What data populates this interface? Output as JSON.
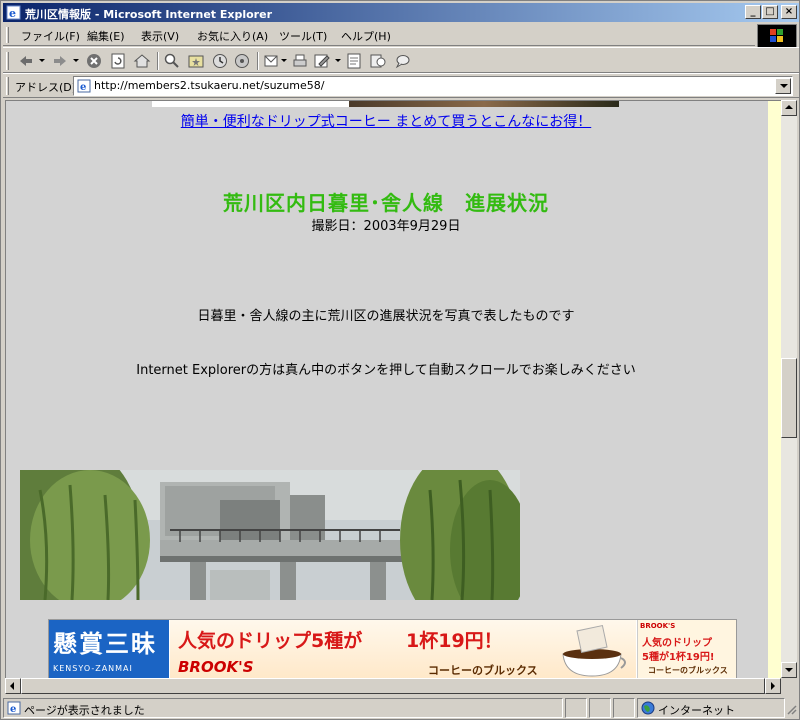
{
  "window": {
    "title": "荒川区情報版 - Microsoft Internet Explorer",
    "minimize_glyph": "_",
    "maximize_glyph": "□",
    "close_glyph": "×"
  },
  "menu": {
    "items": [
      "ファイル(F)",
      "編集(E)",
      "表示(V)",
      "お気に入り(A)",
      "ツール(T)",
      "ヘルプ(H)"
    ]
  },
  "toolbar": {
    "icons": [
      "back-icon",
      "forward-icon",
      "stop-icon",
      "refresh-icon",
      "home-icon",
      "search-icon",
      "favorites-icon",
      "history-icon",
      "mail-icon",
      "print-icon",
      "edit-icon",
      "discuss-icon",
      "messenger-icon"
    ]
  },
  "address": {
    "label": "アドレス(D)",
    "url": "http://members2.tsukaeru.net/suzume58/"
  },
  "page": {
    "ad_link": "簡単・便利なドリップ式コーヒー まとめて買うとこんなにお得！",
    "heading": "荒川区内日暮里･舎人線　進展状況",
    "shoot_date": "撮影日：2003年9月29日",
    "description_1": "日暮里・舎人線の主に荒川区の進展状況を写真で表したものです",
    "description_2": "Internet Explorerの方は真ん中のボタンを押して自動スクロールでお楽しみください"
  },
  "ad_banner": {
    "logo_big": "懸賞三昧",
    "logo_small": "KENSYO-ZANMAI",
    "headline": "人気のドリップ5種が",
    "price": "1杯19円！",
    "brand": "BROOK'S",
    "shop": "コーヒーのブルックス",
    "side_brand": "BROOK'S",
    "side_line1": "人気のドリップ",
    "side_line2": "5種が1杯19円!",
    "side_shop": "コーヒーのブルックス"
  },
  "status": {
    "text": "ページが表示されました",
    "zone": "インターネット"
  },
  "colors": {
    "title_gradient_start": "#0a246a",
    "title_gradient_end": "#a6caf0",
    "heading": "#33bb11",
    "link": "#0000ee",
    "content_bg": "#d3d3d3",
    "chrome": "#d4d0c8"
  }
}
